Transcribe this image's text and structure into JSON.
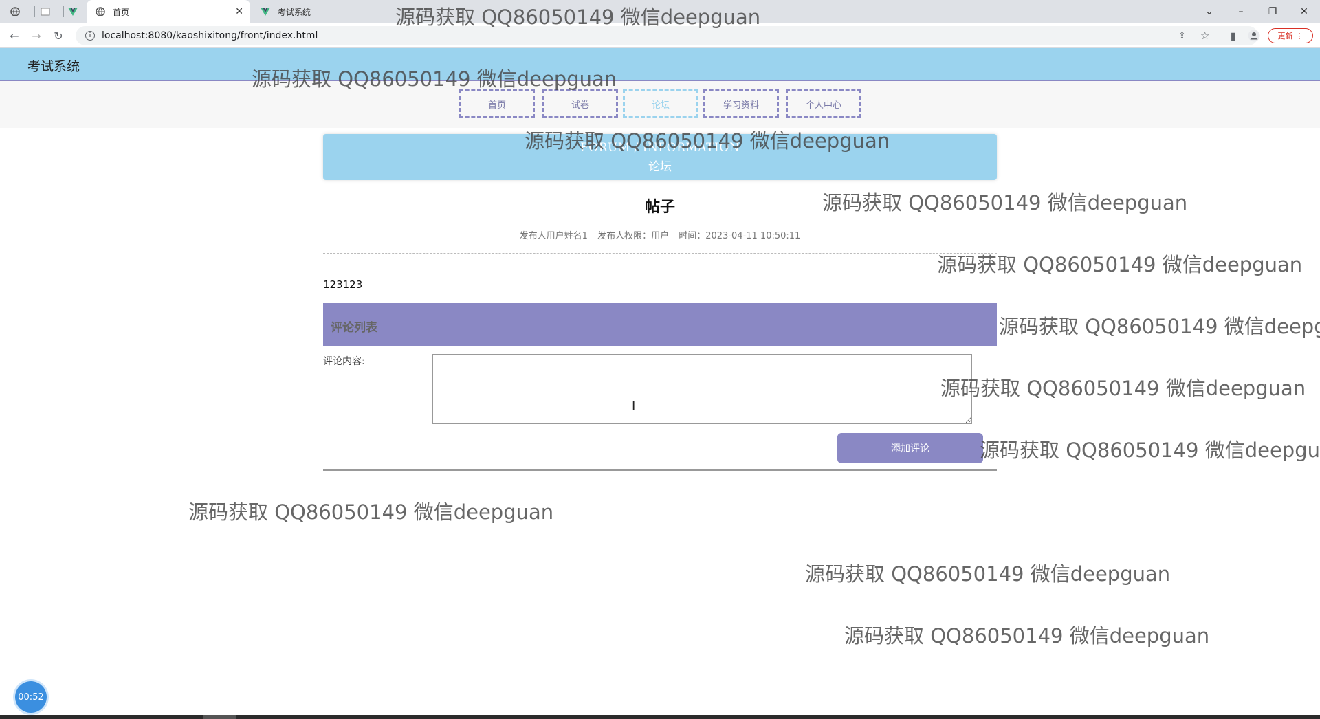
{
  "browser": {
    "tabs": [
      {
        "label": "",
        "icon": "globe-icon"
      },
      {
        "label": "",
        "icon": "blank-page-icon"
      },
      {
        "label": "",
        "icon": "vue-logo-icon"
      },
      {
        "label": "首页",
        "icon": "globe-icon"
      },
      {
        "label": "考试系统",
        "icon": "vue-logo-icon"
      }
    ],
    "url": "localhost:8080/kaoshixitong/front/index.html",
    "update_label": "更新",
    "accent": "#d93025"
  },
  "header": {
    "title": "考试系统",
    "color": "#9bd3ee"
  },
  "nav": {
    "items": [
      {
        "label": "首页"
      },
      {
        "label": "试卷"
      },
      {
        "label": "论坛"
      },
      {
        "label": "学习资料"
      },
      {
        "label": "个人中心"
      }
    ],
    "active": "论坛",
    "border_color": "#8a88c4"
  },
  "banner": {
    "en": "FORUM / INFORMATION",
    "cn": "论坛"
  },
  "post": {
    "title": "帖子",
    "author": "发布人用户姓名1",
    "role": "发布人权限：用户",
    "time": "时间：2023-04-11 10:50:11",
    "content": "123123"
  },
  "comments": {
    "header": "评论列表",
    "label": "评论内容:",
    "value": "",
    "submit_label": "添加评论",
    "color": "#8a88c4"
  },
  "timer": "00:52",
  "watermark": "源码获取 QQ86050149 微信deepguan"
}
